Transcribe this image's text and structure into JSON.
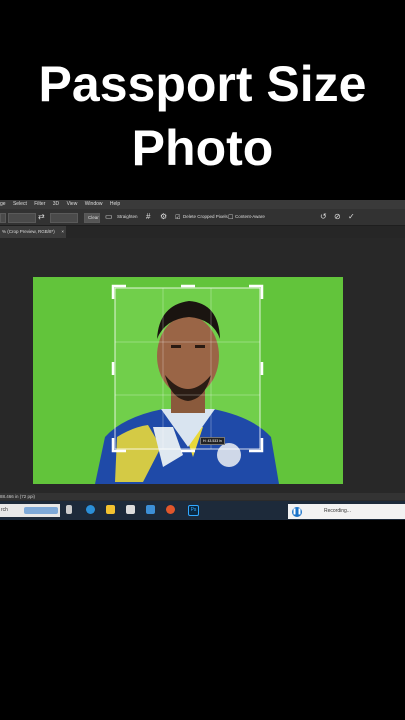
{
  "overlay": {
    "line1": "Passport Size",
    "line2": "Photo"
  },
  "menu": {
    "items": [
      "ge",
      "Select",
      "Filter",
      "3D",
      "View",
      "Window",
      "Help"
    ]
  },
  "options": {
    "clear_label": "Clear",
    "straighten_label": "Straighten",
    "delete_cropped_label": "Delete Cropped Pixels",
    "content_aware_label": "Content-Aware"
  },
  "document_tab": {
    "label": "% (Crop Preview, RGB/8*)",
    "close": "×"
  },
  "crop_tip": {
    "text": "H: 43.533 in"
  },
  "status": {
    "text": "88.466 in (72 ppi)"
  },
  "taskbar": {
    "search_text": "rch"
  },
  "recording": {
    "label": "Recording..."
  },
  "colors": {
    "green_screen": "#62c43b",
    "jersey_blue": "#1f4aa8",
    "jersey_yellow": "#e8d83a"
  }
}
